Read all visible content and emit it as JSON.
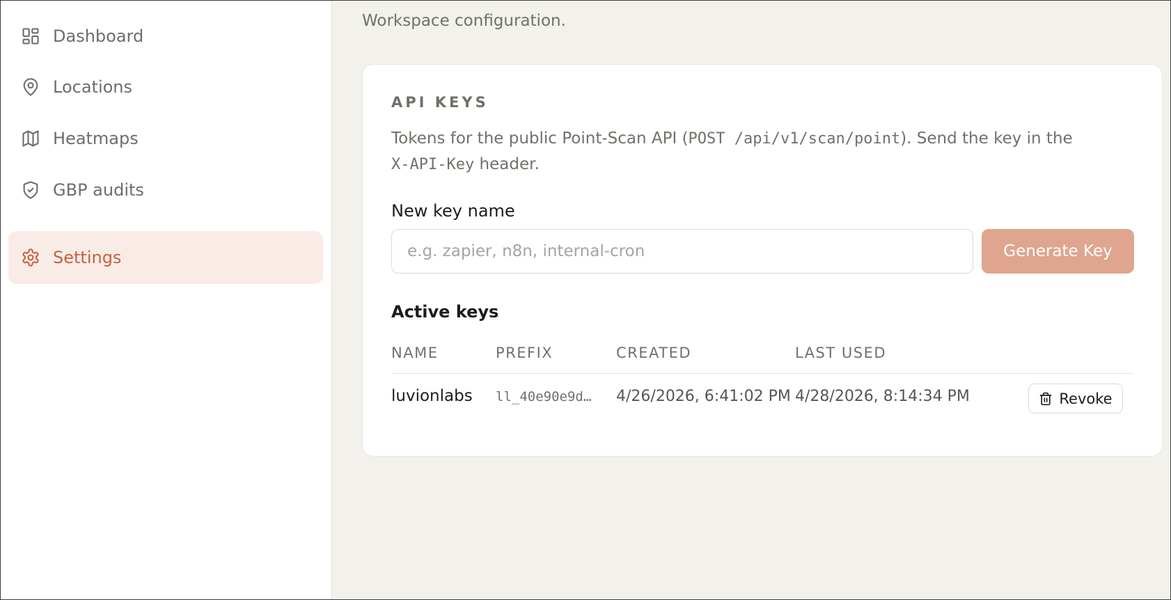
{
  "sidebar": {
    "items": [
      {
        "label": "Dashboard",
        "icon": "dashboard-icon",
        "active": false
      },
      {
        "label": "Locations",
        "icon": "map-pin-icon",
        "active": false
      },
      {
        "label": "Heatmaps",
        "icon": "map-icon",
        "active": false
      },
      {
        "label": "GBP audits",
        "icon": "shield-check-icon",
        "active": false
      },
      {
        "label": "Settings",
        "icon": "gear-icon",
        "active": true
      }
    ]
  },
  "main": {
    "subtitle": "Workspace configuration."
  },
  "api_keys": {
    "title": "API KEYS",
    "desc_prefix": "Tokens for the public Point-Scan API (",
    "desc_endpoint": "POST /api/v1/scan/point",
    "desc_middle": "). Send the key in the ",
    "desc_header": "X-API-Key",
    "desc_suffix": " header.",
    "new_key_label": "New key name",
    "new_key_placeholder": "e.g. zapier, n8n, internal-cron",
    "new_key_value": "",
    "generate_label": "Generate Key",
    "active_keys_title": "Active keys",
    "columns": [
      "NAME",
      "PREFIX",
      "CREATED",
      "LAST USED"
    ],
    "rows": [
      {
        "name": "luvionlabs",
        "prefix": "ll_40e90e9d…",
        "created": "4/26/2026, 6:41:02 PM",
        "last_used": "4/28/2026, 8:14:34 PM",
        "action_label": "Revoke"
      }
    ]
  },
  "colors": {
    "accent": "#c8603c",
    "accent_bg": "#f9ece7",
    "button": "#dfa58e",
    "page_bg": "#f3f1ec"
  }
}
